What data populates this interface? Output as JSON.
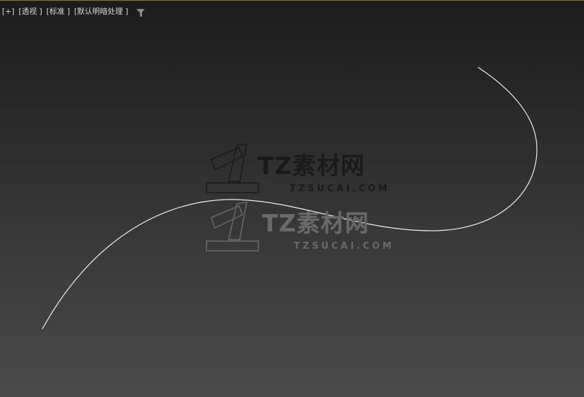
{
  "viewport": {
    "labels": [
      "[+]",
      "[透视 ]",
      "[标准 ]",
      "[默认明暗处理 ]"
    ],
    "filter_icon": "filter-icon"
  },
  "watermark": {
    "title": "TZ素材网",
    "url": "TZSUCAI.COM"
  }
}
